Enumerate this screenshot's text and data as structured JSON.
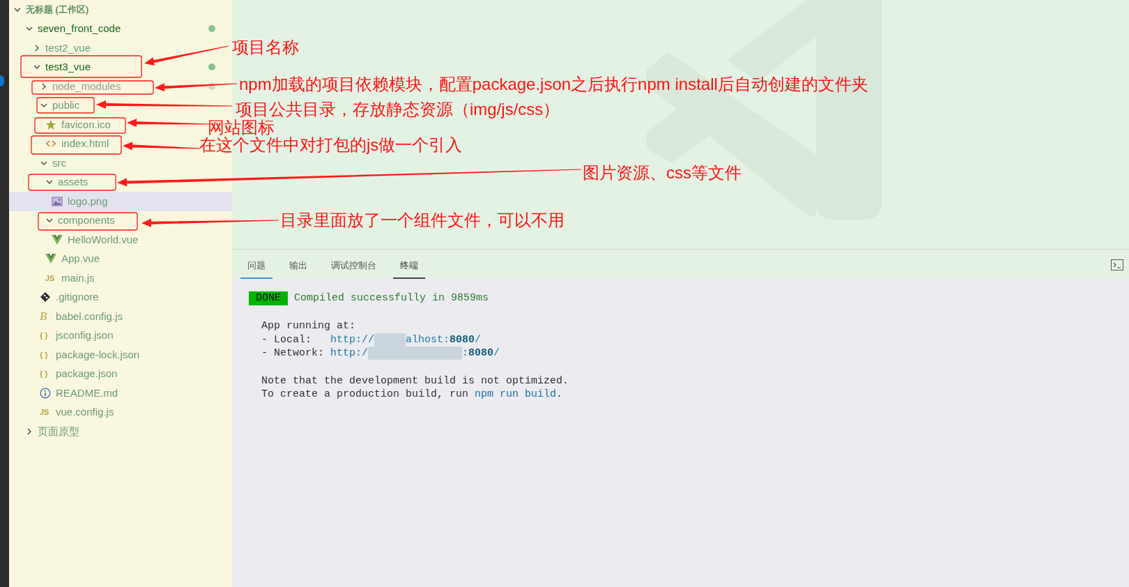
{
  "explorer": {
    "tree": [
      {
        "label": "无标题 (工作区)",
        "kind": "workspace",
        "expanded": true,
        "selected": false,
        "modified": false,
        "ignored": false,
        "children": [
          {
            "label": "seven_front_code",
            "kind": "folder",
            "expanded": true,
            "selected": false,
            "modified": true,
            "ignored": false,
            "children": [
              {
                "label": "test2_vue",
                "kind": "folder",
                "expanded": false,
                "selected": false,
                "modified": false,
                "ignored": false
              },
              {
                "label": "test3_vue",
                "kind": "folder",
                "expanded": true,
                "selected": false,
                "modified": true,
                "ignored": false,
                "children": [
                  {
                    "label": "node_modules",
                    "kind": "folder",
                    "expanded": false,
                    "selected": false,
                    "modified": false,
                    "ignored": true
                  },
                  {
                    "label": "public",
                    "kind": "folder",
                    "expanded": true,
                    "selected": false,
                    "modified": false,
                    "ignored": false,
                    "children": [
                      {
                        "label": "favicon.ico",
                        "kind": "star",
                        "selected": false,
                        "modified": false,
                        "ignored": false
                      },
                      {
                        "label": "index.html",
                        "kind": "html",
                        "selected": false,
                        "modified": false,
                        "ignored": false
                      }
                    ]
                  },
                  {
                    "label": "src",
                    "kind": "folder",
                    "expanded": true,
                    "selected": false,
                    "modified": false,
                    "ignored": false,
                    "children": [
                      {
                        "label": "assets",
                        "kind": "folder",
                        "expanded": true,
                        "selected": false,
                        "modified": false,
                        "ignored": false,
                        "children": [
                          {
                            "label": "logo.png",
                            "kind": "image",
                            "selected": true,
                            "modified": false,
                            "ignored": false
                          }
                        ]
                      },
                      {
                        "label": "components",
                        "kind": "folder",
                        "expanded": true,
                        "selected": false,
                        "modified": false,
                        "ignored": false,
                        "children": [
                          {
                            "label": "HelloWorld.vue",
                            "kind": "vue",
                            "selected": false,
                            "modified": false,
                            "ignored": false
                          }
                        ]
                      },
                      {
                        "label": "App.vue",
                        "kind": "vue",
                        "selected": false,
                        "modified": false,
                        "ignored": false
                      },
                      {
                        "label": "main.js",
                        "kind": "badge",
                        "badge": "JS",
                        "selected": false,
                        "modified": false,
                        "ignored": false
                      }
                    ]
                  },
                  {
                    "label": ".gitignore",
                    "kind": "git",
                    "selected": false,
                    "modified": false,
                    "ignored": false
                  },
                  {
                    "label": "babel.config.js",
                    "kind": "script",
                    "badge": "B",
                    "selected": false,
                    "modified": false,
                    "ignored": false
                  },
                  {
                    "label": "jsconfig.json",
                    "kind": "badge",
                    "badge": "{ }",
                    "selected": false,
                    "modified": false,
                    "ignored": false
                  },
                  {
                    "label": "package-lock.json",
                    "kind": "badge",
                    "badge": "{ }",
                    "selected": false,
                    "modified": false,
                    "ignored": false
                  },
                  {
                    "label": "package.json",
                    "kind": "badge",
                    "badge": "{ }",
                    "selected": false,
                    "modified": false,
                    "ignored": false
                  },
                  {
                    "label": "README.md",
                    "kind": "info",
                    "selected": false,
                    "modified": false,
                    "ignored": false
                  },
                  {
                    "label": "vue.config.js",
                    "kind": "badge",
                    "badge": "JS",
                    "selected": false,
                    "modified": false,
                    "ignored": false
                  }
                ]
              }
            ]
          },
          {
            "label": "页面原型",
            "kind": "folder",
            "expanded": false,
            "selected": false,
            "modified": false,
            "ignored": false
          }
        ]
      }
    ]
  },
  "panel": {
    "tabs": [
      {
        "label": "问题",
        "selected": false,
        "focused": true
      },
      {
        "label": "输出",
        "selected": false,
        "focused": false
      },
      {
        "label": "调试控制台",
        "selected": false,
        "focused": false
      },
      {
        "label": "终端",
        "selected": true,
        "focused": false
      }
    ],
    "terminal": {
      "status": {
        "badge": "DONE",
        "message": "Compiled successfully in 9859ms"
      },
      "blocks": [
        [
          [
            {
              "kind": "plain",
              "text": "App running at:"
            }
          ],
          [
            {
              "kind": "plain",
              "text": "- Local:   "
            },
            {
              "kind": "link",
              "text": "http://"
            },
            {
              "kind": "redacted"
            },
            {
              "kind": "link",
              "text": "alhost:"
            },
            {
              "kind": "port",
              "text": "8080"
            },
            {
              "kind": "link",
              "text": "/"
            }
          ],
          [
            {
              "kind": "plain",
              "text": "- Network: "
            },
            {
              "kind": "link",
              "text": "http:/"
            },
            {
              "kind": "redacted"
            },
            {
              "kind": "link",
              "text": ":"
            },
            {
              "kind": "port",
              "text": "8080"
            },
            {
              "kind": "link",
              "text": "/"
            }
          ]
        ],
        [
          [
            {
              "kind": "plain",
              "text": "Note that the development build is not optimized."
            }
          ],
          [
            {
              "kind": "plain",
              "text": "To create a production build, run "
            },
            {
              "kind": "command",
              "text": "npm run build"
            },
            {
              "kind": "plain",
              "text": "."
            }
          ]
        ]
      ]
    }
  },
  "annotations": [
    {
      "text": "项目名称"
    },
    {
      "text": "npm加载的项目依赖模块，配置package.json之后执行npm install后自动创建的文件夹"
    },
    {
      "text": "项目公共目录，存放静态资源（img/js/css）"
    },
    {
      "text": "网站图标"
    },
    {
      "text": "在这个文件中对打包的js做一个引入"
    },
    {
      "text": "图片资源、css等文件"
    },
    {
      "text": "目录里面放了一个组件文件，可以不用"
    }
  ]
}
